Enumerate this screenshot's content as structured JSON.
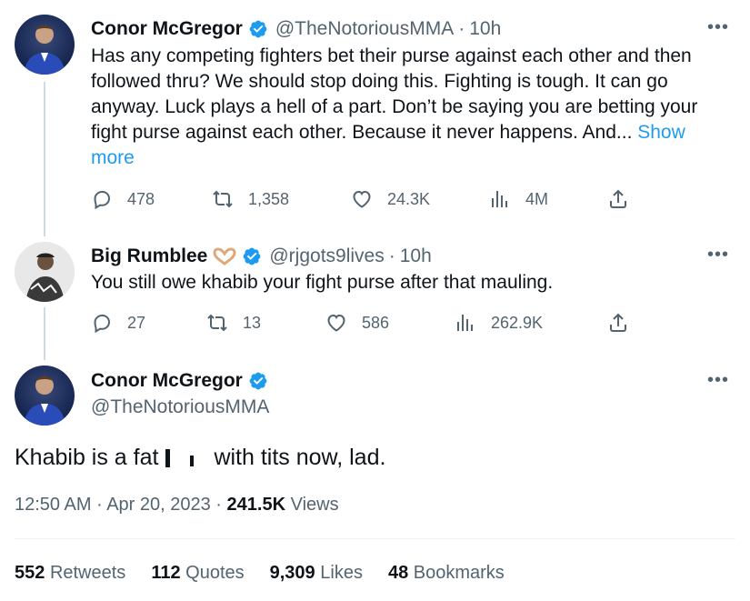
{
  "colors": {
    "accent": "#1d9bf0",
    "muted": "#536471",
    "text": "#0f1419"
  },
  "tweet1": {
    "name": "Conor McGregor",
    "handle": "@TheNotoriousMMA",
    "sep": "·",
    "time": "10h",
    "more_icon": "more-icon",
    "text": "Has any competing fighters bet their purse against each other and then followed thru? We should stop doing this. Fighting is tough. It can go anyway. Luck plays a hell of a part. Don’t be saying you are betting your fight purse against each other. Because it never happens. And... ",
    "show_more": "Show more",
    "replies": "478",
    "retweets": "1,358",
    "likes": "24.3K",
    "views": "4M"
  },
  "tweet2": {
    "name": "Big Rumblee",
    "handle": "@rjgots9lives",
    "sep": "·",
    "time": "10h",
    "text": "You still owe khabib your fight purse after that mauling.",
    "replies": "27",
    "retweets": "13",
    "likes": "586",
    "views": "262.9K"
  },
  "main": {
    "name": "Conor McGregor",
    "handle": "@TheNotoriousMMA",
    "text_before": "Khabib is a fat",
    "text_after": "with tits now, lad.",
    "time": "12:50 AM",
    "sep1": "·",
    "date": "Apr 20, 2023",
    "sep2": "·",
    "views_count": "241.5K",
    "views_label": "Views",
    "retweets_count": "552",
    "retweets_label": "Retweets",
    "quotes_count": "112",
    "quotes_label": "Quotes",
    "likes_count": "9,309",
    "likes_label": "Likes",
    "bookmarks_count": "48",
    "bookmarks_label": "Bookmarks"
  }
}
